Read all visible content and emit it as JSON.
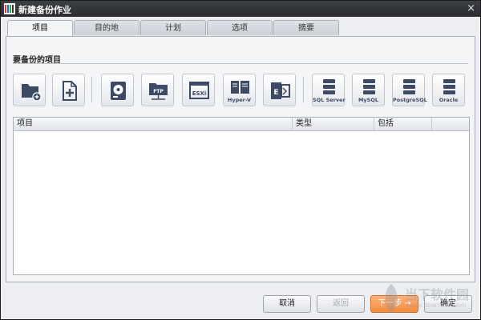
{
  "window": {
    "title": "新建备份作业",
    "close_glyph": "×"
  },
  "tabs": [
    {
      "label": "项目",
      "active": true
    },
    {
      "label": "目的地"
    },
    {
      "label": "计划"
    },
    {
      "label": "选项"
    },
    {
      "label": "摘要"
    }
  ],
  "section": {
    "label": "要备份的项目"
  },
  "source_buttons": [
    {
      "name": "add-folder",
      "icon": "folder-plus-icon",
      "caption": ""
    },
    {
      "name": "add-file",
      "icon": "file-plus-icon",
      "caption": ""
    },
    {
      "name": "disk",
      "icon": "hard-disk-icon",
      "caption": ""
    },
    {
      "name": "ftp",
      "icon": "ftp-folder-icon",
      "caption": ""
    },
    {
      "name": "esxi",
      "icon": "esxi-icon",
      "caption": ""
    },
    {
      "name": "hyperv",
      "icon": "hyperv-icon",
      "caption": "Hyper-V"
    },
    {
      "name": "exchange",
      "icon": "exchange-icon",
      "caption": ""
    },
    {
      "name": "sqlserver",
      "icon": "database-icon",
      "caption": "SQL Server"
    },
    {
      "name": "mysql",
      "icon": "database-icon",
      "caption": "MySQL"
    },
    {
      "name": "postgresql",
      "icon": "database-icon",
      "caption": "PostgreSQL"
    },
    {
      "name": "oracle",
      "icon": "database-icon",
      "caption": "Oracle"
    }
  ],
  "icon_labels": {
    "ftp": "FTP",
    "esxi": "ESXi",
    "exchange": "E"
  },
  "list": {
    "columns": [
      "项目",
      "类型",
      "包括"
    ]
  },
  "footer": {
    "cancel": "取消",
    "back": "返回",
    "next": "下一步 →",
    "ok": "确定"
  },
  "watermark": {
    "text": "当下软件园",
    "sub": "www.downxia.com"
  },
  "colors": {
    "accent": "#f58a3f",
    "icon": "#3d4a66",
    "titlebar": "#2f3236"
  }
}
